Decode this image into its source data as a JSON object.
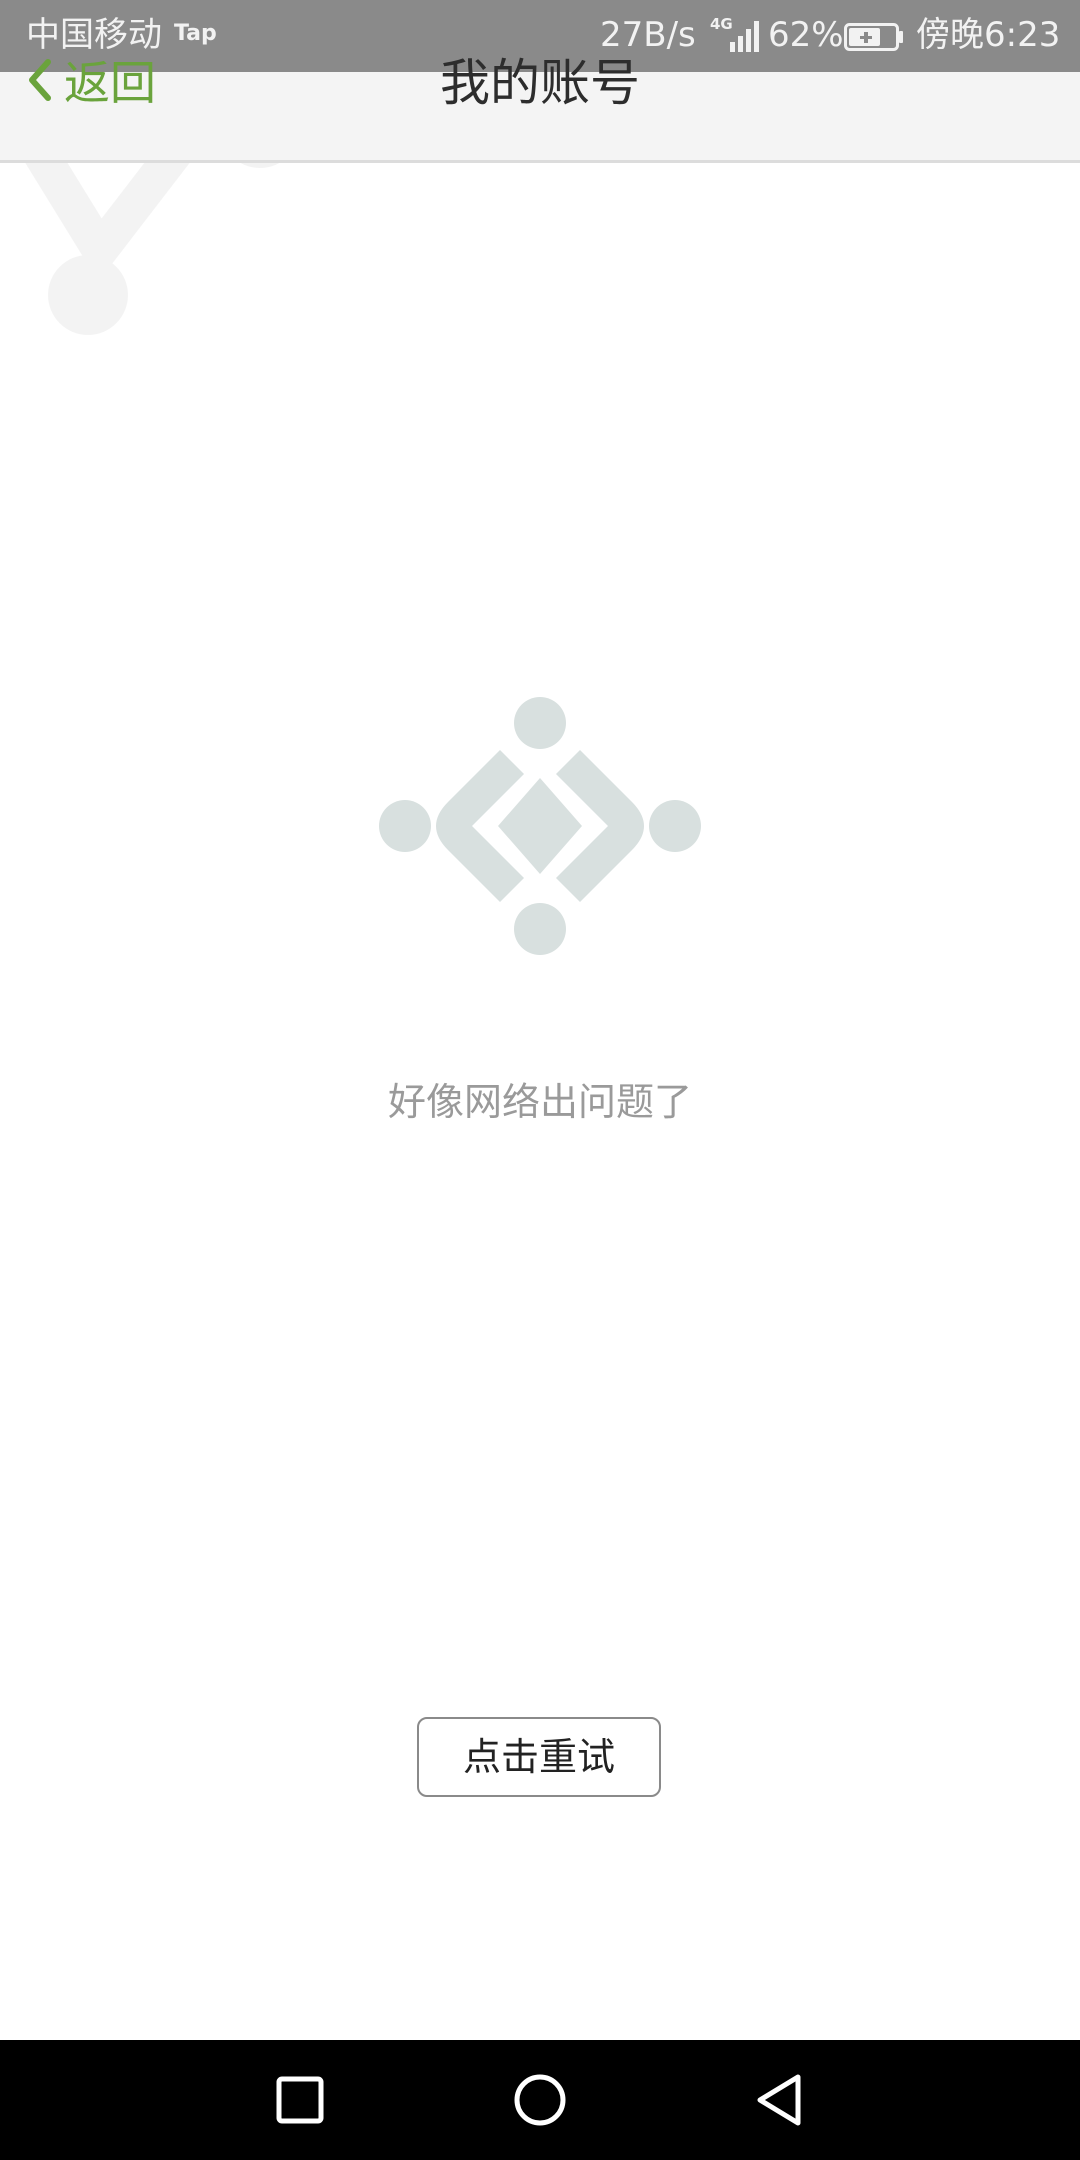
{
  "status_bar": {
    "carrier": "中国移动",
    "tap_badge": "Tap",
    "network_speed": "27B/s",
    "network_type": "4G",
    "battery_percent": "62%",
    "time": "傍晚6:23"
  },
  "header": {
    "back_label": "返回",
    "title": "我的账号"
  },
  "error": {
    "message": "好像网络出问题了",
    "retry_label": "点击重试"
  },
  "colors": {
    "accent_green": "#6aa33c",
    "logo_gray": "#d8e0df",
    "status_bar_bg": "#8a8a8a",
    "nav_bar_bg": "#000000"
  },
  "icons": {
    "back": "chevron-left-icon",
    "logo": "diamond-logo-icon",
    "nav_recent": "square-icon",
    "nav_home": "circle-icon",
    "nav_back": "triangle-back-icon"
  }
}
